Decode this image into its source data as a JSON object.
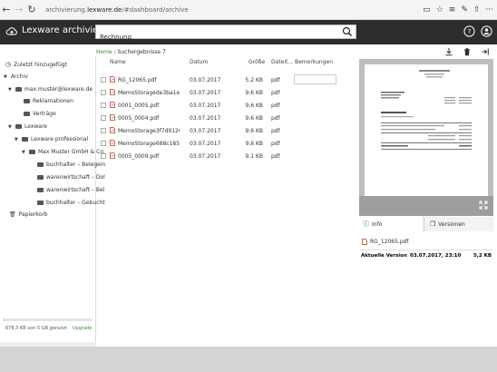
{
  "browser": {
    "url_prefix": "archivierung.",
    "url_host": "lexware.de",
    "url_path": "/#dashboard/archive"
  },
  "app": {
    "title": "Lexware archivierung",
    "search_value": "Rechnung"
  },
  "breadcrumb": {
    "home": "Home",
    "separator": " / ",
    "current": "Suchergebnisse 7"
  },
  "sidebar": {
    "recent": "Zuletzt hinzugefügt",
    "archive": "Archiv",
    "account": "max.muster@lexware.de",
    "folder_reklamationen": "Reklamationen",
    "folder_vertraege": "Verträge",
    "lexware": "Lexware",
    "lexware_professional": "Lexware professional",
    "company": "Max Muster GmbH & Co.",
    "sub1": "buchhalter – Belegein",
    "sub2": "warenwirtschaft – Dol",
    "sub3": "warenwirtschaft – Bel",
    "sub4": "buchhalter – Gebucht",
    "trash": "Papierkorb",
    "storage_text": "678,3 KB von 5 GB genutzt",
    "upgrade": "Upgrade",
    "storage_used_fraction": 0.0001
  },
  "table": {
    "headers": {
      "name": "Name",
      "date": "Datum",
      "size": "Größe",
      "type": "Dateit...",
      "remarks": "Bemerkungen"
    },
    "rows": [
      {
        "name": "RG_12065.pdf",
        "date": "03.07.2017",
        "size": "5,2 KB",
        "type": "pdf"
      },
      {
        "name": "MemoStoragede3ba1ea...",
        "date": "03.07.2017",
        "size": "9,6 KB",
        "type": "pdf"
      },
      {
        "name": "0001_0005.pdf",
        "date": "03.07.2017",
        "size": "9,6 KB",
        "type": "pdf"
      },
      {
        "name": "0005_0004.pdf",
        "date": "03.07.2017",
        "size": "9,6 KB",
        "type": "pdf"
      },
      {
        "name": "MemoStorage3f7d9120...",
        "date": "03.07.2017",
        "size": "9,6 KB",
        "type": "pdf"
      },
      {
        "name": "MemoStorage688c1856...",
        "date": "03.07.2017",
        "size": "9,6 KB",
        "type": "pdf"
      },
      {
        "name": "0005_0009.pdf",
        "date": "03.07.2017",
        "size": "9,1 KB",
        "type": "pdf"
      }
    ]
  },
  "detail": {
    "tab_info": "Info",
    "tab_versions": "Versionen",
    "version_file": "RG_12065.pdf",
    "current_version_label": "Aktuelle Version",
    "current_version_date": "03.07.2017, 23:10",
    "current_version_size": "5,2 KB"
  },
  "colors": {
    "appbar": "#2d2d2d",
    "accent_green": "#3a8a3a",
    "pdf_red": "#c0392b"
  }
}
